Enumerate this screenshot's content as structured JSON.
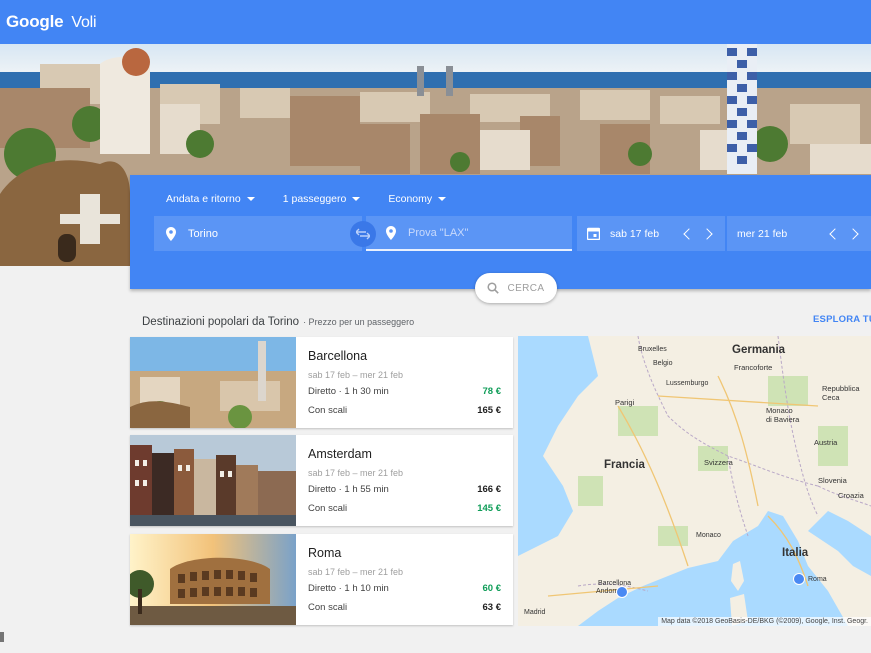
{
  "app": {
    "logo_google": "Google",
    "product": "Voli"
  },
  "search": {
    "trip_type": "Andata e ritorno",
    "passengers": "1 passeggero",
    "cabin": "Economy",
    "origin": "Torino",
    "destination_placeholder": "Prova \"LAX\"",
    "depart_date": "sab 17 feb",
    "return_date": "mer 21 feb",
    "search_button": "CERCA"
  },
  "section": {
    "title": "Destinazioni popolari da Torino",
    "subtitle": "· Prezzo per un passeggero",
    "explore": "ESPLORA TUTTO"
  },
  "destinations": [
    {
      "city": "Barcellona",
      "dates": "sab 17 feb – mer 21 feb",
      "direct": "Diretto · 1 h 30 min",
      "direct_price": "78 €",
      "stops": "Con scali",
      "stops_price": "165 €"
    },
    {
      "city": "Amsterdam",
      "dates": "sab 17 feb – mer 21 feb",
      "direct": "Diretto · 1 h 55 min",
      "direct_price": "166 €",
      "stops": "Con scali",
      "stops_price": "145 €"
    },
    {
      "city": "Roma",
      "dates": "sab 17 feb – mer 21 feb",
      "direct": "Diretto · 1 h 10 min",
      "direct_price": "60 €",
      "stops": "Con scali",
      "stops_price": "63 €"
    }
  ],
  "map": {
    "labels": {
      "germania": "Germania",
      "francia": "Francia",
      "italia": "Italia",
      "svizzera": "Svizzera",
      "austria": "Austria",
      "bruxelles": "Bruxelles",
      "belgio": "Belgio",
      "lussemburgo": "Lussemburgo",
      "francoforte": "Francoforte",
      "monaco_baviera": "Monaco\ndi Baviera",
      "parigi": "Parigi",
      "repubblica_ceca": "Repubblica\nCeca",
      "slovenia": "Slovenia",
      "croazia": "Croazia",
      "monaco": "Monaco",
      "andorra": "Andorra",
      "barcellona": "Barcellona",
      "madrid": "Madrid",
      "roma": "Roma"
    },
    "attribution": "Map data ©2018 GeoBasis-DE/BKG (©2009), Google, Inst. Geogr."
  },
  "colors": {
    "brand": "#4285f4",
    "price_best": "#0f9d58"
  }
}
